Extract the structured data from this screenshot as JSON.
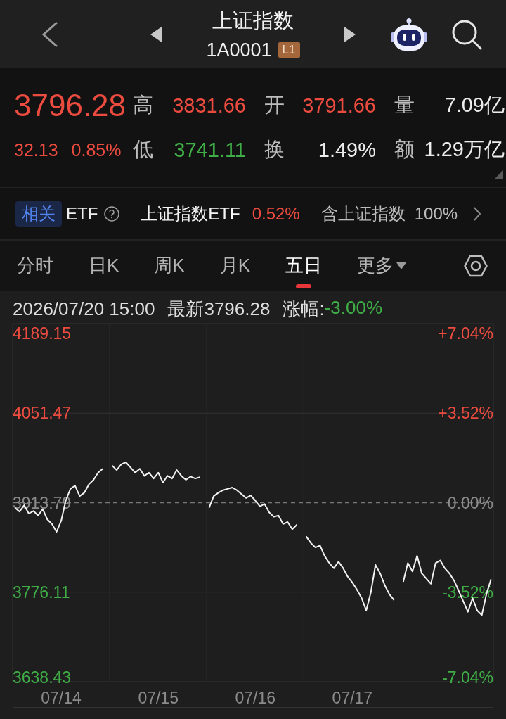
{
  "nav": {
    "title": "上证指数",
    "code": "1A0001",
    "level_badge": "L1"
  },
  "quote": {
    "price": "3796.28",
    "change": "32.13",
    "change_pct": "0.85%",
    "rising": true,
    "stats": [
      {
        "label": "高",
        "value": "3831.66",
        "color": "#ec4b3f"
      },
      {
        "label": "开",
        "value": "3791.66",
        "color": "#ec4b3f"
      },
      {
        "label": "量",
        "value": "7.09亿",
        "color": "#ececec"
      },
      {
        "label": "低",
        "value": "3741.11",
        "color": "#3fae46"
      },
      {
        "label": "换",
        "value": "1.49%",
        "color": "#ececec"
      },
      {
        "label": "额",
        "value": "1.29万亿",
        "color": "#ececec"
      }
    ]
  },
  "etf_bar": {
    "tag": "相关",
    "label": "ETF",
    "fund_name": "上证指数ETF",
    "fund_change": "0.52%",
    "fund_rising": true,
    "holding_label": "含上证指数",
    "holding_value": "100%"
  },
  "tabs": [
    {
      "label": "分时",
      "selected": false,
      "kind": "period"
    },
    {
      "label": "日K",
      "selected": false,
      "kind": "period"
    },
    {
      "label": "周K",
      "selected": false,
      "kind": "period"
    },
    {
      "label": "月K",
      "selected": false,
      "kind": "period"
    },
    {
      "label": "五日",
      "selected": true,
      "kind": "period"
    },
    {
      "label": "更多",
      "selected": false,
      "kind": "menu"
    }
  ],
  "chart": {
    "time": "2026/07/20 15:00",
    "latest": "最新3796.28",
    "change_label": "涨幅:",
    "change": "-3.00%",
    "change_rising": false,
    "axis_levels": [
      {
        "percent": "+7.04%",
        "color": "#ec4b3f"
      },
      {
        "percent": "+3.52%",
        "color": "#ec4b3f"
      },
      {
        "percent": "0.00%",
        "color": "#8c8c8c"
      },
      {
        "percent": "-3.52%",
        "color": "#3fae46"
      },
      {
        "percent": "-7.04%",
        "color": "#3fae46"
      }
    ],
    "chart_data": {
      "type": "line",
      "ylim": [
        3638.43,
        4189.15
      ],
      "yticks": [
        4189.15,
        4051.47,
        3913.79,
        3776.11,
        3638.43
      ],
      "ref_lines": [
        {
          "axis": "y",
          "value": 3913.79
        }
      ],
      "categories": [
        null,
        null,
        null,
        null,
        null,
        null,
        null,
        null,
        null,
        null,
        "07/14",
        null,
        null,
        null,
        null,
        null,
        null,
        null,
        null,
        null,
        null,
        null,
        null,
        null,
        null,
        null,
        null,
        null,
        null,
        null,
        null,
        "07/15",
        null,
        null,
        null,
        null,
        null,
        null,
        null,
        null,
        null,
        null,
        null,
        null,
        null,
        null,
        null,
        null,
        null,
        null,
        null,
        null,
        "07/16",
        null,
        null,
        null,
        null,
        null,
        null,
        null,
        null,
        null,
        null,
        null,
        null,
        null,
        null,
        null,
        null,
        null,
        null,
        null,
        null,
        "07/17",
        null,
        null,
        null,
        null,
        null,
        null,
        null,
        null,
        null,
        null,
        null,
        null,
        null,
        null,
        null,
        null,
        null,
        null,
        null,
        null,
        null,
        null,
        null,
        null,
        null,
        null,
        null,
        null,
        null,
        null
      ],
      "values": [
        3906,
        3900,
        3910,
        3897,
        3901,
        3894,
        3904,
        3888,
        3881,
        3869,
        3886,
        3917,
        3935,
        3940,
        3924,
        3929,
        3942,
        3949,
        3960,
        3966,
        null,
        3971,
        3964,
        3973,
        3976,
        3968,
        3960,
        3966,
        3955,
        3960,
        3951,
        3960,
        3945,
        3955,
        3951,
        3964,
        3955,
        3949,
        3954,
        3951,
        3953,
        null,
        3906,
        3924,
        3929,
        3933,
        3935,
        3937,
        3933,
        3927,
        3921,
        3925,
        3917,
        3908,
        3912,
        3899,
        3892,
        3894,
        3881,
        3884,
        3873,
        3880,
        null,
        3862,
        3852,
        3845,
        3848,
        3832,
        3821,
        3813,
        3823,
        3813,
        3800,
        3791,
        3780,
        3767,
        3748,
        3776,
        3818,
        3805,
        3787,
        3773,
        3764,
        null,
        3792,
        3821,
        3808,
        3832,
        3805,
        3797,
        3789,
        3821,
        3825,
        3813,
        3805,
        3794,
        3778,
        3762,
        3746,
        3767,
        3748,
        3741,
        3773,
        3796
      ]
    }
  }
}
